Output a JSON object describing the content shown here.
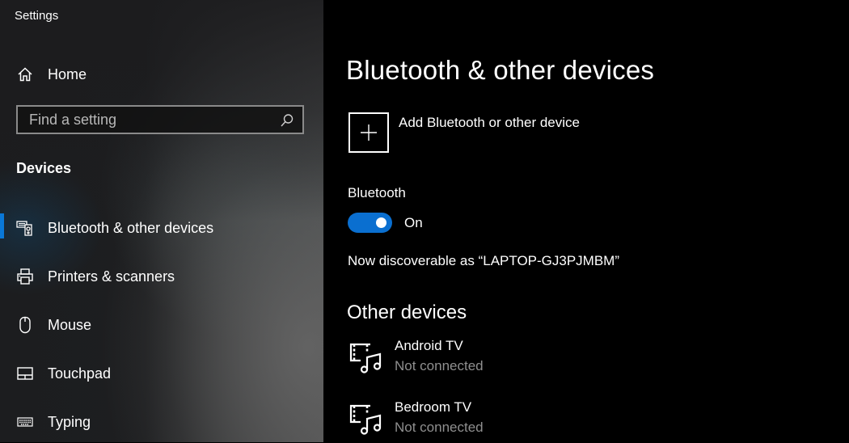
{
  "window": {
    "title": "Settings"
  },
  "sidebar": {
    "home_label": "Home",
    "search": {
      "placeholder": "Find a setting",
      "value": ""
    },
    "section_title": "Devices",
    "items": [
      {
        "label": "Bluetooth & other devices",
        "icon": "bluetooth-devices-icon",
        "active": true
      },
      {
        "label": "Printers & scanners",
        "icon": "printer-icon",
        "active": false
      },
      {
        "label": "Mouse",
        "icon": "mouse-icon",
        "active": false
      },
      {
        "label": "Touchpad",
        "icon": "touchpad-icon",
        "active": false
      },
      {
        "label": "Typing",
        "icon": "keyboard-icon",
        "active": false
      }
    ]
  },
  "main": {
    "title": "Bluetooth & other devices",
    "add_device_label": "Add Bluetooth or other device",
    "bluetooth": {
      "label": "Bluetooth",
      "state": "On",
      "enabled": true,
      "discoverable_text": "Now discoverable as “LAPTOP-GJ3PJMBM”"
    },
    "other_devices": {
      "title": "Other devices",
      "devices": [
        {
          "name": "Android TV",
          "status": "Not connected",
          "icon": "media-device-icon"
        },
        {
          "name": "Bedroom TV",
          "status": "Not connected",
          "icon": "media-device-icon"
        }
      ]
    }
  },
  "colors": {
    "accent": "#0a78d7",
    "toggle_on": "#0a6fd0",
    "secondary_text": "#8f8f8f",
    "main_background": "#000000"
  }
}
